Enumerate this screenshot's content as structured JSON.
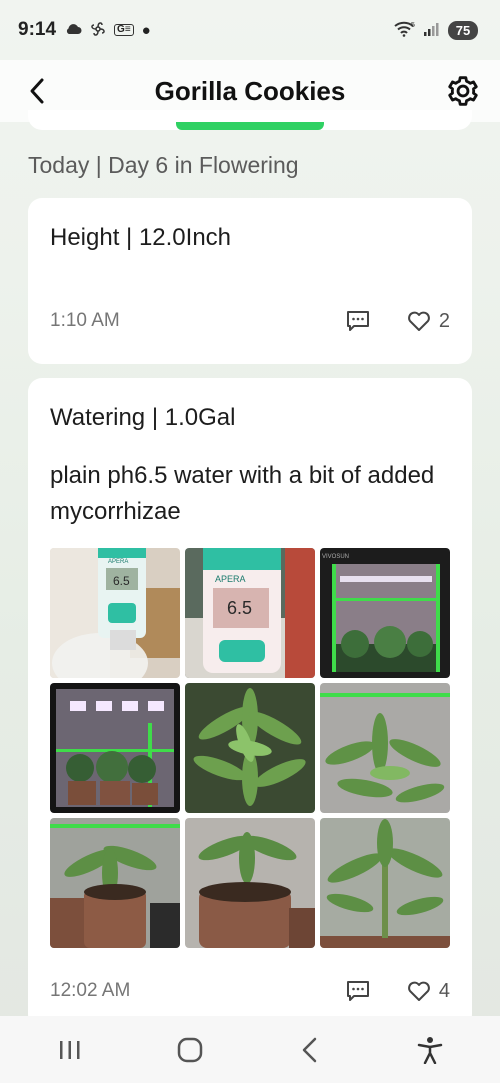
{
  "status_bar": {
    "time": "9:14",
    "left_icons": [
      "cloud-icon",
      "fan-icon",
      "g-icon",
      "dot-icon"
    ],
    "g_label": "G",
    "signal": "5",
    "battery": "75"
  },
  "header": {
    "title": "Gorilla Cookies",
    "back_icon": "chevron-left-icon",
    "settings_icon": "gear-icon"
  },
  "section": {
    "title": "Today | Day 6 in Flowering"
  },
  "entries": [
    {
      "title": "Height | 12.0Inch",
      "time": "1:10 AM",
      "likes": "2"
    },
    {
      "title": "Watering | 1.0Gal",
      "note": "plain ph6.5 water with a bit of added mycorrhizae",
      "time": "12:02 AM",
      "likes": "4",
      "photos": [
        {
          "desc": "ph-meter-jug",
          "meter_text": "6.5",
          "brand": "APERA"
        },
        {
          "desc": "ph-meter-closeup",
          "meter_text": "6.5",
          "brand": "APERA"
        },
        {
          "desc": "grow-tent-wide",
          "brand": "VIVOSUN"
        },
        {
          "desc": "grow-tent-lights"
        },
        {
          "desc": "cannabis-leaves-1"
        },
        {
          "desc": "cannabis-leaves-2"
        },
        {
          "desc": "pots-closeup-1"
        },
        {
          "desc": "pots-closeup-2"
        },
        {
          "desc": "plant-stem"
        }
      ]
    }
  ],
  "nav": [
    "recent-apps-icon",
    "home-icon",
    "back-icon",
    "accessibility-icon"
  ],
  "colors": {
    "accent_green": "#2fd163",
    "card_bg": "#ffffff",
    "muted_text": "#767676"
  }
}
